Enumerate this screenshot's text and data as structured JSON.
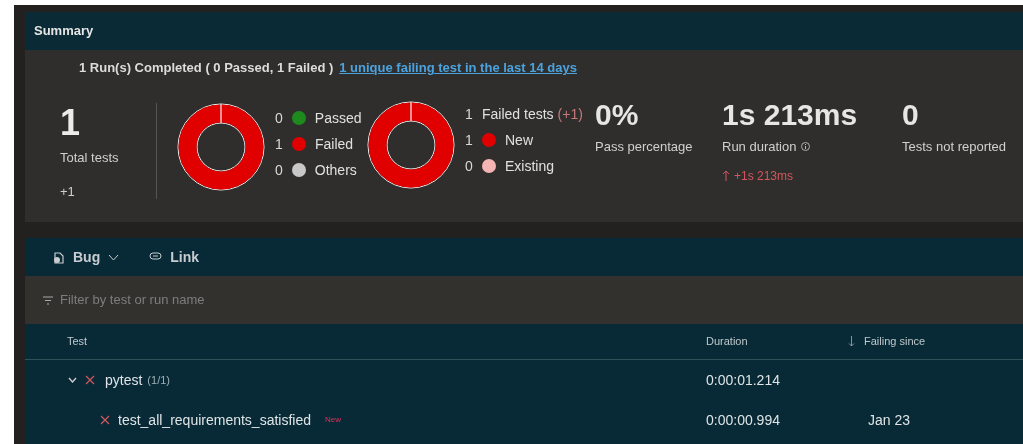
{
  "summary": {
    "title": "Summary",
    "runs_text": "1 Run(s) Completed ( 0 Passed, 1 Failed )",
    "failing_link": "1 unique failing test in the last 14 days",
    "total": {
      "value": "1",
      "label": "Total tests",
      "delta": "+1"
    },
    "outcome_legend": [
      {
        "count": "0",
        "label": "Passed",
        "color": "#1e8a1e"
      },
      {
        "count": "1",
        "label": "Failed",
        "color": "#e00000"
      },
      {
        "count": "0",
        "label": "Others",
        "color": "#c8c8c8"
      }
    ],
    "failed_summary": {
      "count": "1",
      "label": "Failed tests",
      "delta": "(+1)"
    },
    "failed_legend": [
      {
        "count": "1",
        "label": "New",
        "color": "#e00000"
      },
      {
        "count": "0",
        "label": "Existing",
        "color": "#f4b4b4"
      }
    ],
    "metrics": [
      {
        "value": "0%",
        "label": "Pass percentage",
        "info": false
      },
      {
        "value": "1s 213ms",
        "label": "Run duration",
        "info": true,
        "delta": "+1s 213ms"
      },
      {
        "value": "0",
        "label": "Tests not reported",
        "info": false
      }
    ]
  },
  "toolbar": [
    {
      "kind": "bug",
      "label": "Bug"
    },
    {
      "kind": "link",
      "label": "Link"
    }
  ],
  "filter": {
    "placeholder": "Filter by test or run name"
  },
  "table": {
    "columns": [
      {
        "label": "Test",
        "sorted": false
      },
      {
        "label": "Duration",
        "sorted": false
      },
      {
        "label": "Failing since",
        "sorted": true
      }
    ],
    "rows": [
      {
        "name": "pytest",
        "count": "(1/1)",
        "expanded": true,
        "duration": "0:00:01.214",
        "failing_since": "",
        "children": [
          {
            "name": "test_all_requirements_satisfied",
            "badge": "New",
            "duration": "0:00:00.994",
            "failing_since": "Jan 23"
          }
        ]
      }
    ]
  }
}
